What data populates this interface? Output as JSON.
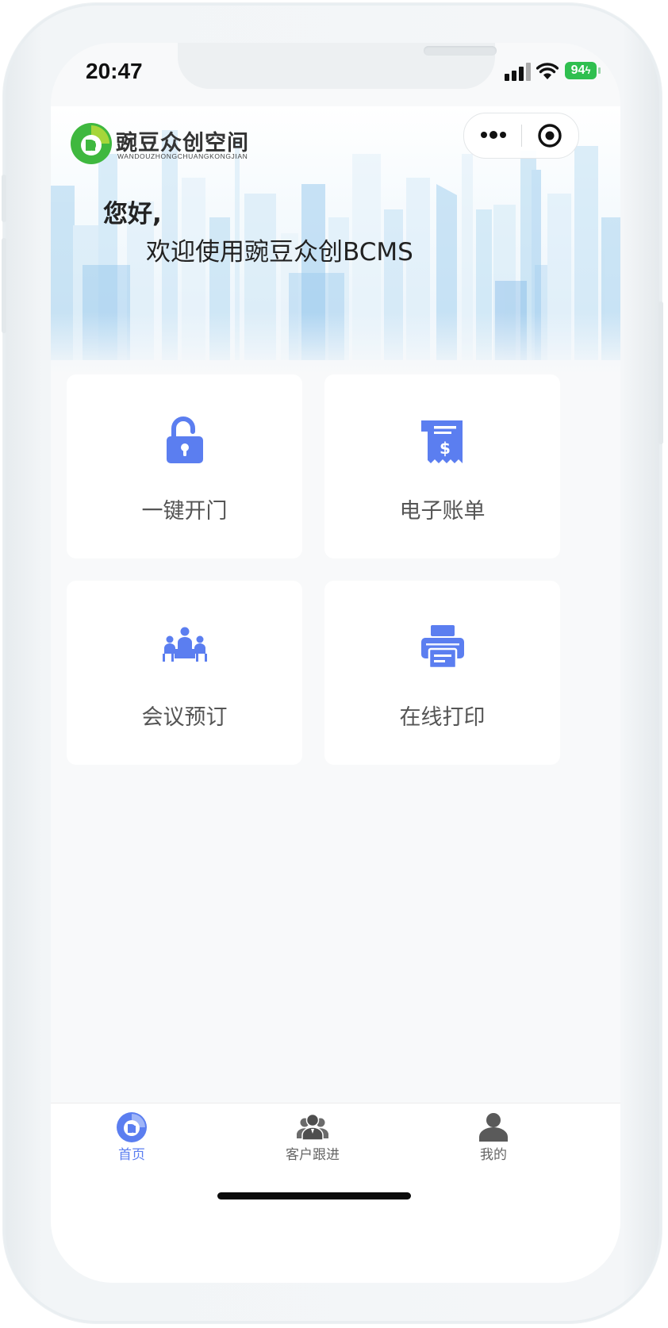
{
  "status_bar": {
    "time": "20:47",
    "battery_percent": "94",
    "icons": [
      "cellular-signal-icon",
      "wifi-icon",
      "battery-charging-icon"
    ]
  },
  "header": {
    "logo_cn": "豌豆众创空间",
    "logo_en": "WANDOUZHONGCHUANGKONGJIAN",
    "capsule_icons": [
      "more-options-icon",
      "close-miniprogram-icon"
    ]
  },
  "greeting": {
    "line1": "您好,",
    "line2": "欢迎使用豌豆众创BCMS"
  },
  "actions": [
    {
      "label": "一键开门",
      "icon": "unlock-icon"
    },
    {
      "label": "电子账单",
      "icon": "bill-icon"
    },
    {
      "label": "会议预订",
      "icon": "meeting-icon"
    },
    {
      "label": "在线打印",
      "icon": "printer-icon"
    }
  ],
  "tabbar": {
    "tabs": [
      {
        "label": "首页",
        "icon": "home-logo-icon",
        "active": true
      },
      {
        "label": "客户跟进",
        "icon": "customers-icon",
        "active": false
      },
      {
        "label": "我的",
        "icon": "profile-icon",
        "active": false
      }
    ]
  },
  "colors": {
    "accent": "#5b7ef0",
    "logo_green": "#3fb83f",
    "page_bg": "#f8f9fa",
    "card_bg": "#ffffff"
  }
}
